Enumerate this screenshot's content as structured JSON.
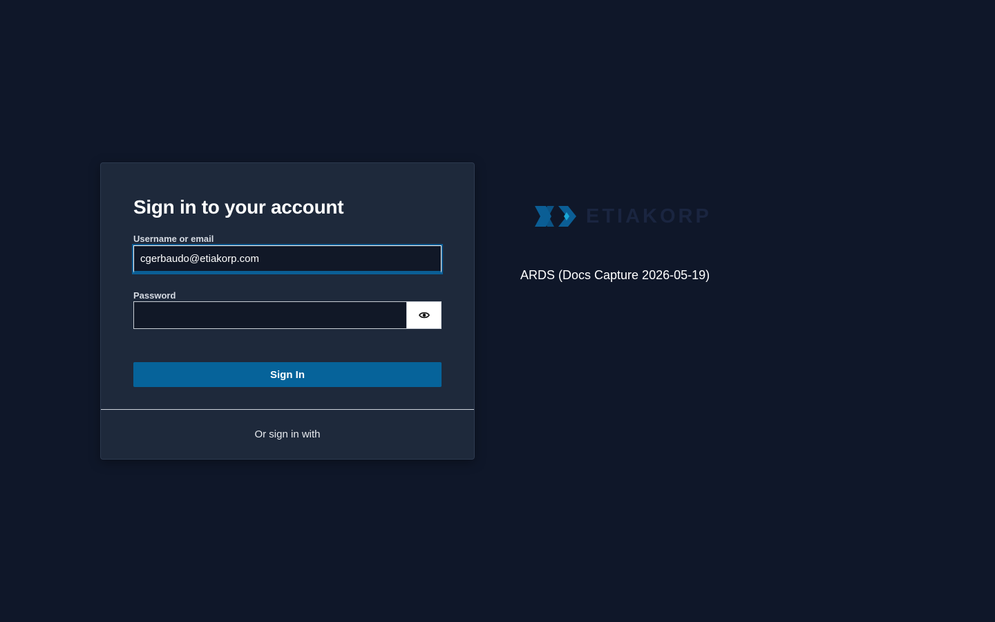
{
  "login": {
    "title": "Sign in to your account",
    "username_label": "Username or email",
    "username_value": "cgerbaudo@etiakorp.com",
    "password_label": "Password",
    "password_value": "",
    "password_toggle_icon": "eye-icon",
    "signin_label": "Sign In",
    "alt_signin_text": "Or sign in with"
  },
  "brand": {
    "logo_text": "ETIAKORP",
    "realm_name": "ARDS (Docs Capture 2026-05-19)",
    "colors": {
      "accent": "#06639a",
      "logo_mark": "#0b5e95",
      "logo_diamond": "#1aa7d6",
      "logo_text": "#1a2540",
      "background": "#0f1729",
      "card": "#1e293b"
    }
  }
}
